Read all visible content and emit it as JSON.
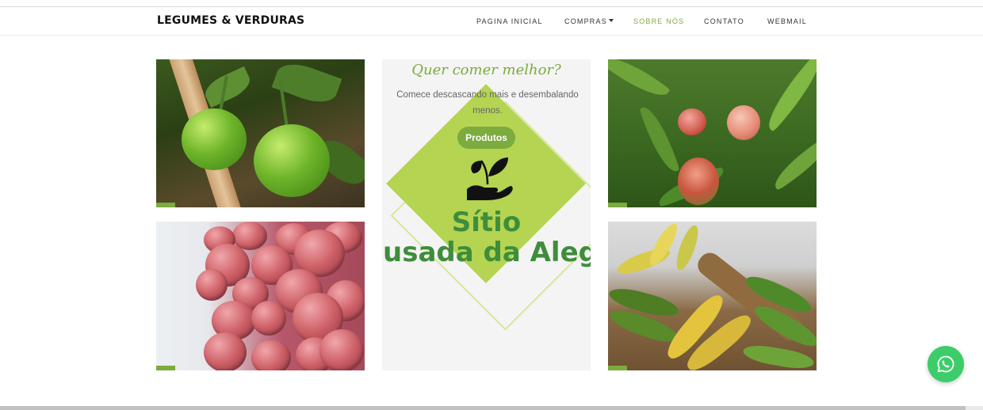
{
  "header": {
    "brand": "LEGUMES & VERDURAS",
    "nav": [
      {
        "label": "PAGINA INICIAL"
      },
      {
        "label": "COMPRAS",
        "has_dropdown": true
      },
      {
        "label": "SOBRE NÓS",
        "active": true
      },
      {
        "label": "CONTATO"
      },
      {
        "label": "WEBMAIL"
      }
    ]
  },
  "gallery": {
    "promo": {
      "heading": "Quer comer melhor?",
      "subtitle": "Comece descascando mais e desembalando menos.",
      "button_label": "Produtos",
      "logo_text_line1": "Sítio",
      "logo_text_line2": "usada da Aleg"
    },
    "photos": [
      {
        "subject": "green tomatoes"
      },
      {
        "subject": "mangoes on tree"
      },
      {
        "subject": "lychees"
      },
      {
        "subject": "bananas in basket"
      }
    ]
  },
  "colors": {
    "accent": "#7cab3e",
    "logo_green": "#3f8d3b",
    "diamond": "#b4d452",
    "whatsapp": "#3ccd6a"
  },
  "icons": {
    "whatsapp": "whatsapp-icon",
    "logo": "hand-sprout-icon",
    "dropdown": "caret-down-icon"
  }
}
